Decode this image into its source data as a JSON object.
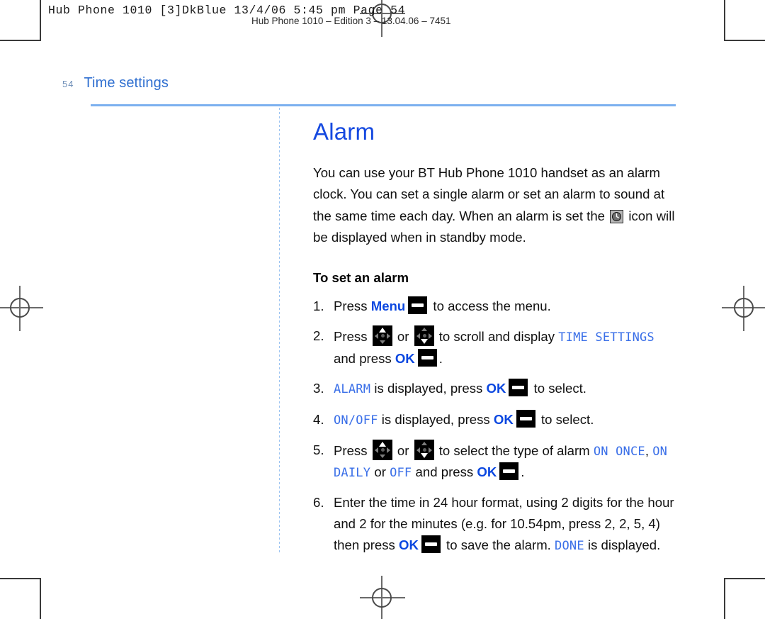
{
  "prepress": {
    "slug_top": "Hub Phone 1010  [3]DkBlue   13/4/06  5:45 pm   Page 54",
    "slug_sub": "Hub Phone 1010 – Edition 3 – 13.04.06 – 7451",
    "marks": {
      "registration": "registration-mark",
      "corner": "crop-corner-mark"
    }
  },
  "running_head": {
    "folio": "54",
    "chapter": "Time settings"
  },
  "section": {
    "title": "Alarm",
    "intro_1": "You can use your BT Hub Phone 1010 handset as an alarm clock. You can set a single alarm or set an alarm to sound at the same time each day. When an alarm is set the ",
    "intro_2": " icon will be displayed when in standby mode.",
    "sub_head": "To set an alarm"
  },
  "steps": {
    "s1": {
      "a": "Press ",
      "key_menu": "Menu",
      "b": " to access the menu."
    },
    "s2": {
      "a": "Press ",
      "b": " or ",
      "c": " to scroll and display ",
      "lcd_time_settings": "TIME SETTINGS",
      "d": " and press ",
      "key_ok": "OK",
      "e": "."
    },
    "s3": {
      "lcd_alarm": "ALARM",
      "a": " is displayed, press ",
      "key_ok": "OK",
      "b": " to select."
    },
    "s4": {
      "lcd_onoff": "ON/OFF",
      "a": " is displayed, press ",
      "key_ok": "OK",
      "b": " to select."
    },
    "s5": {
      "a": "Press ",
      "b": " or ",
      "c": " to select the type of alarm ",
      "lcd_on_once": "ON ONCE",
      "d": ", ",
      "lcd_on_daily": "ON DAILY",
      "e": " or ",
      "lcd_off": "OFF",
      "f": " and press ",
      "key_ok": "OK",
      "g": "."
    },
    "s6": {
      "a": "Enter the time in 24 hour format, using 2 digits for the hour and 2 for the minutes (e.g. for 10.54pm, press 2, 2, 5, 4) then press ",
      "key_ok": "OK",
      "b": " to save the alarm. ",
      "lcd_done": "DONE",
      "c": " is displayed."
    }
  },
  "colors": {
    "heading_blue": "#1549e0",
    "chapter_blue": "#2f6fd0",
    "rule_blue": "#7cb0ef",
    "lcd_blue": "#3a6fe8",
    "key_blue": "#0b47e0"
  }
}
